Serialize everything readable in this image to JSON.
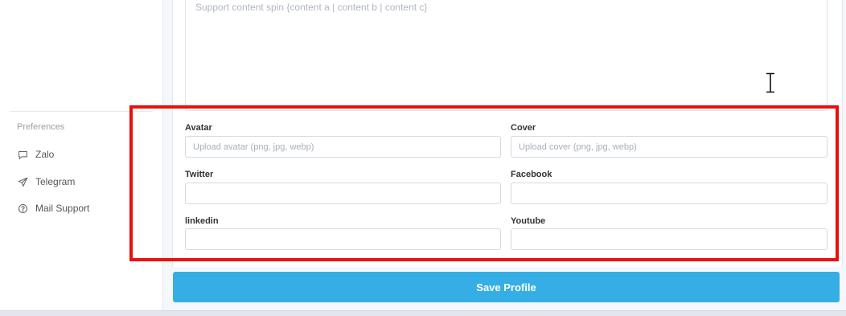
{
  "editor": {
    "placeholder": "Support content spin {content a | content b | content c}"
  },
  "sidebar": {
    "heading": "Preferences",
    "items": [
      {
        "label": "Zalo",
        "icon": "chat-bubble-icon"
      },
      {
        "label": "Telegram",
        "icon": "send-icon"
      },
      {
        "label": "Mail Support",
        "icon": "help-circle-icon"
      }
    ]
  },
  "form": {
    "avatar": {
      "label": "Avatar",
      "placeholder": "Upload avatar (png, jpg, webp)",
      "value": ""
    },
    "cover": {
      "label": "Cover",
      "placeholder": "Upload cover (png, jpg, webp)",
      "value": ""
    },
    "twitter": {
      "label": "Twitter",
      "value": ""
    },
    "facebook": {
      "label": "Facebook",
      "value": ""
    },
    "linkedin": {
      "label": "linkedin",
      "value": ""
    },
    "youtube": {
      "label": "Youtube",
      "value": ""
    }
  },
  "actions": {
    "save_label": "Save Profile"
  },
  "colors": {
    "accent": "#35aee6",
    "highlight": "#e8120c"
  }
}
